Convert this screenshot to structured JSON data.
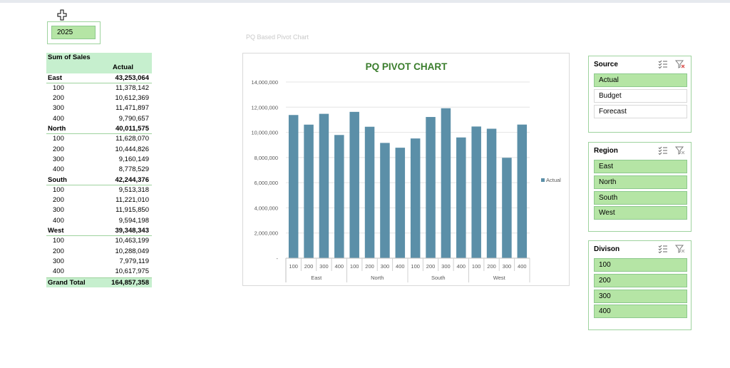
{
  "year_slicer": {
    "value": "2025"
  },
  "chart_subtitle": "PQ Based Pivot Chart",
  "pivot": {
    "header": "Sum of Sales",
    "column": "Actual",
    "regions": [
      {
        "name": "East",
        "total": "43,253,064",
        "items": [
          {
            "name": "100",
            "value": "11,378,142"
          },
          {
            "name": "200",
            "value": "10,612,369"
          },
          {
            "name": "300",
            "value": "11,471,897"
          },
          {
            "name": "400",
            "value": "9,790,657"
          }
        ]
      },
      {
        "name": "North",
        "total": "40,011,575",
        "items": [
          {
            "name": "100",
            "value": "11,628,070"
          },
          {
            "name": "200",
            "value": "10,444,826"
          },
          {
            "name": "300",
            "value": "9,160,149"
          },
          {
            "name": "400",
            "value": "8,778,529"
          }
        ]
      },
      {
        "name": "South",
        "total": "42,244,376",
        "items": [
          {
            "name": "100",
            "value": "9,513,318"
          },
          {
            "name": "200",
            "value": "11,221,010"
          },
          {
            "name": "300",
            "value": "11,915,850"
          },
          {
            "name": "400",
            "value": "9,594,198"
          }
        ]
      },
      {
        "name": "West",
        "total": "39,348,343",
        "items": [
          {
            "name": "100",
            "value": "10,463,199"
          },
          {
            "name": "200",
            "value": "10,288,049"
          },
          {
            "name": "300",
            "value": "7,979,119"
          },
          {
            "name": "400",
            "value": "10,617,975"
          }
        ]
      }
    ],
    "grand_total_label": "Grand Total",
    "grand_total": "164,857,358"
  },
  "chart_data": {
    "type": "bar",
    "title": "PQ PIVOT CHART",
    "title_color": "#3a7d2c",
    "bar_color": "#5b8fa8",
    "groups": [
      "East",
      "North",
      "South",
      "West"
    ],
    "categories": [
      "100",
      "200",
      "300",
      "400"
    ],
    "series": [
      {
        "name": "Actual",
        "values": [
          11378142,
          10612369,
          11471897,
          9790657,
          11628070,
          10444826,
          9160149,
          8778529,
          9513318,
          11221010,
          11915850,
          9594198,
          10463199,
          10288049,
          7979119,
          10617975
        ]
      }
    ],
    "ylim": [
      0,
      14000000
    ],
    "yticks": [
      "-",
      "2,000,000",
      "4,000,000",
      "6,000,000",
      "8,000,000",
      "10,000,000",
      "12,000,000",
      "14,000,000"
    ],
    "grid": true,
    "legend": "right"
  },
  "slicers": [
    {
      "title": "Source",
      "filter_active": true,
      "items": [
        {
          "label": "Actual",
          "selected": true
        },
        {
          "label": "Budget",
          "selected": false
        },
        {
          "label": "Forecast",
          "selected": false
        }
      ]
    },
    {
      "title": "Region",
      "filter_active": false,
      "items": [
        {
          "label": "East",
          "selected": true
        },
        {
          "label": "North",
          "selected": true
        },
        {
          "label": "South",
          "selected": true
        },
        {
          "label": "West",
          "selected": true
        }
      ]
    },
    {
      "title": "Divison",
      "filter_active": false,
      "items": [
        {
          "label": "100",
          "selected": true
        },
        {
          "label": "200",
          "selected": true
        },
        {
          "label": "300",
          "selected": true
        },
        {
          "label": "400",
          "selected": true
        }
      ]
    }
  ]
}
